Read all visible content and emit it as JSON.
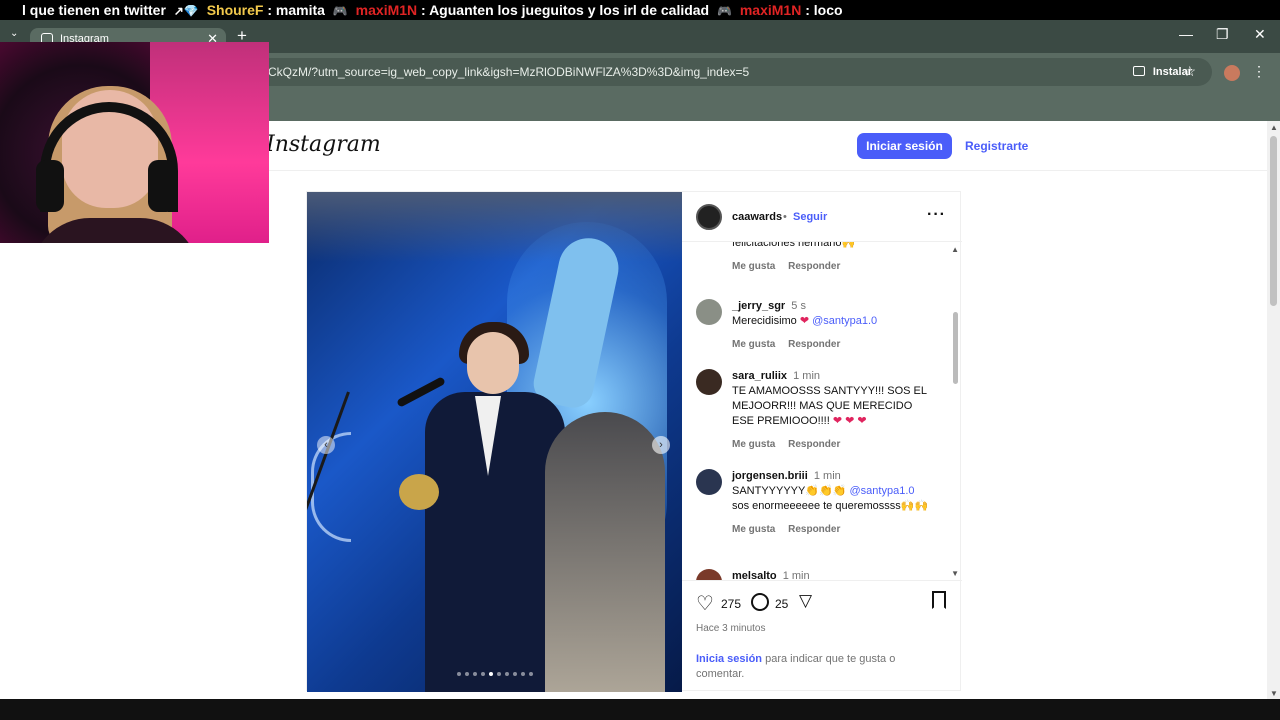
{
  "stream_chat": [
    {
      "user": "",
      "text": "l que tienen en twitter"
    },
    {
      "user": "ShoureF",
      "text": ": mamita"
    },
    {
      "user": "maxiM1N",
      "text": ": Aguanten los jueguitos y los irl de calidad"
    },
    {
      "user": "maxiM1N",
      "text": ": loco"
    }
  ],
  "browser": {
    "tab_title": "Instagram",
    "url": "CkQzM/?utm_source=ig_web_copy_link&igsh=MzRlODBiNWFlZA%3D%3D&img_index=5",
    "install_label": "Instalar",
    "new_tab": "+",
    "tab_close": "✕",
    "tab_list": "⌄",
    "minimize": "—",
    "maximize": "❐",
    "close": "✕",
    "star": "☆",
    "menu": "⋮"
  },
  "instagram": {
    "logo": "Instagram",
    "login_button": "Iniciar sesión",
    "signup_link": "Registrarte",
    "post": {
      "author": "caawards",
      "separator": "•",
      "follow": "Seguir",
      "more": "···",
      "likes": "275",
      "comments_count": "25",
      "time_ago": "Hace 3 minutos",
      "carousel_prev": "‹",
      "carousel_next": "›",
      "carousel_index": 5,
      "carousel_total": 10,
      "login_prompt_link": "Inicia sesión",
      "login_prompt_rest": " para indicar que te gusta o comentar."
    },
    "comments": [
      {
        "user": "",
        "time": "",
        "text": "felicitaciones hermano🙌",
        "mention": "",
        "after": "",
        "like": "Me gusta",
        "reply": "Responder",
        "avatar_color": "#fff"
      },
      {
        "user": "_jerry_sgr",
        "time": "5 s",
        "text": "Merecidisimo ",
        "heart": "❤",
        "mention": "@santypa1.0",
        "after": "",
        "like": "Me gusta",
        "reply": "Responder",
        "avatar_color": "#8a8f86"
      },
      {
        "user": "sara_ruliix",
        "time": "1 min",
        "text": "TE AMAMOOSSS SANTYYY!!! SOS EL MEJOORR!!! MAS QUE MERECIDO ESE PREMIOOO!!!! ",
        "heart": "❤ ❤ ❤",
        "mention": "",
        "after": "",
        "like": "Me gusta",
        "reply": "Responder",
        "avatar_color": "#3a2a22"
      },
      {
        "user": "jorgensen.briii",
        "time": "1 min",
        "text": "SANTYYYYYY👏👏👏 ",
        "mention": "@santypa1.0",
        "after": "sos enormeeeeee te queremossss🙌🙌",
        "like": "Me gusta",
        "reply": "Responder",
        "avatar_color": "#2a3550"
      },
      {
        "user": "melsalto",
        "time": "1 min",
        "text": "",
        "mention": "",
        "after": "",
        "like": "",
        "reply": "",
        "avatar_color": "#7a3a2a"
      }
    ]
  }
}
